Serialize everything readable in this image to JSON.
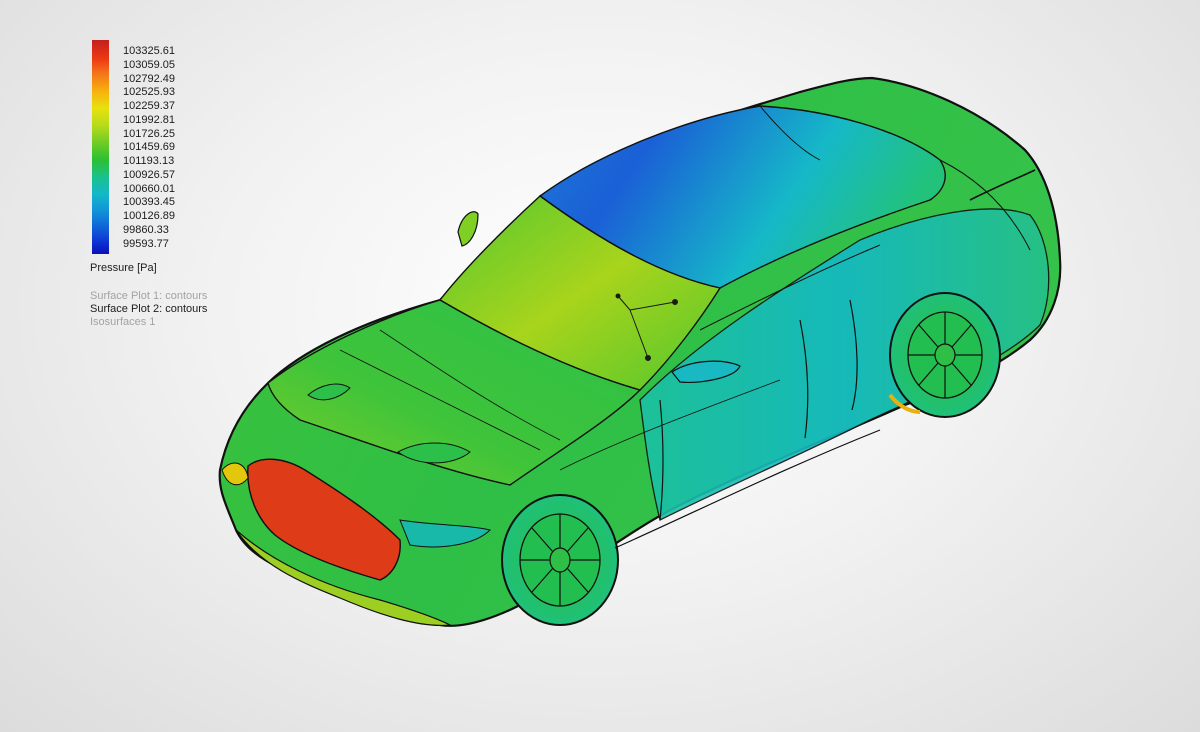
{
  "legend": {
    "ticks": [
      "103325.61",
      "103059.05",
      "102792.49",
      "102525.93",
      "102259.37",
      "101992.81",
      "101726.25",
      "101459.69",
      "101193.13",
      "100926.57",
      "100660.01",
      "100393.45",
      "100126.89",
      "99860.33",
      "99593.77"
    ],
    "title": "Pressure [Pa]"
  },
  "plots": [
    {
      "label": "Surface Plot 1: contours",
      "active": false
    },
    {
      "label": "Surface Plot 2: contours",
      "active": true
    },
    {
      "label": "Isosurfaces 1",
      "active": false
    }
  ],
  "colors": {
    "max_pressure": "#c21f1f",
    "high": "#f7b20c",
    "mid": "#2bc032",
    "low": "#12b8c8",
    "min_pressure": "#0a10b8",
    "edge": "#111111"
  }
}
